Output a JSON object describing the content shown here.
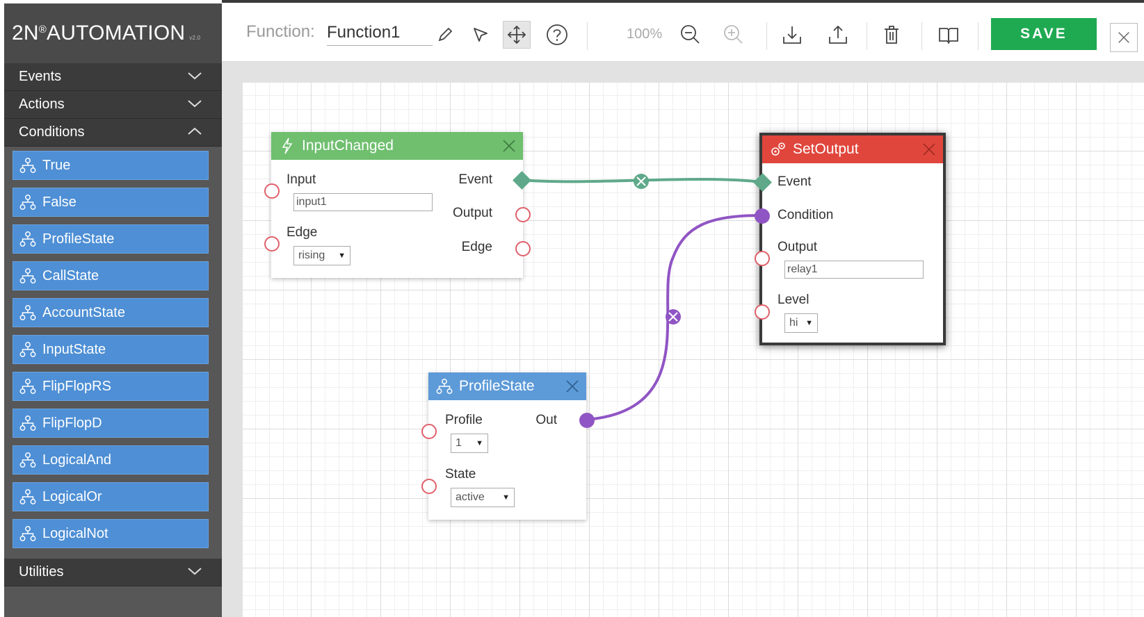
{
  "app": {
    "title": "2N",
    "title_mark": "®",
    "title_rest": " AUTOMATION",
    "version": "v2.0"
  },
  "sidebar": {
    "sections": [
      {
        "label": "Events",
        "state": "collapsed"
      },
      {
        "label": "Actions",
        "state": "collapsed"
      },
      {
        "label": "Conditions",
        "state": "expanded"
      },
      {
        "label": "Utilities",
        "state": "collapsed"
      }
    ],
    "conditions": [
      "True",
      "False",
      "ProfileState",
      "CallState",
      "AccountState",
      "InputState",
      "FlipFlopRS",
      "FlipFlopD",
      "LogicalAnd",
      "LogicalOr",
      "LogicalNot"
    ]
  },
  "toolbar": {
    "function_label": "Function:",
    "function_name": "Function1",
    "zoom": "100%",
    "save_label": "SAVE",
    "icons": [
      "pencil-icon",
      "pointer-icon",
      "move-icon",
      "help-icon",
      "zoom-out-icon",
      "zoom-in-icon",
      "download-icon",
      "upload-icon",
      "trash-icon",
      "book-icon",
      "close-icon"
    ]
  },
  "nodes": {
    "input_changed": {
      "title": "InputChanged",
      "input_label": "Input",
      "input_value": "input1",
      "edge_label": "Edge",
      "edge_value": "rising",
      "out_event": "Event",
      "out_output": "Output",
      "out_edge": "Edge",
      "color": "#6fbf6f"
    },
    "set_output": {
      "title": "SetOutput",
      "event_label": "Event",
      "condition_label": "Condition",
      "output_label": "Output",
      "output_value": "relay1",
      "level_label": "Level",
      "level_value": "hi",
      "color": "#e0463c"
    },
    "profile_state": {
      "title": "ProfileState",
      "profile_label": "Profile",
      "profile_value": "1",
      "state_label": "State",
      "state_value": "active",
      "out_label": "Out",
      "color": "#5d9ad8"
    }
  },
  "wires": {
    "event_color": "#5fa98a",
    "condition_color": "#9055c4"
  }
}
